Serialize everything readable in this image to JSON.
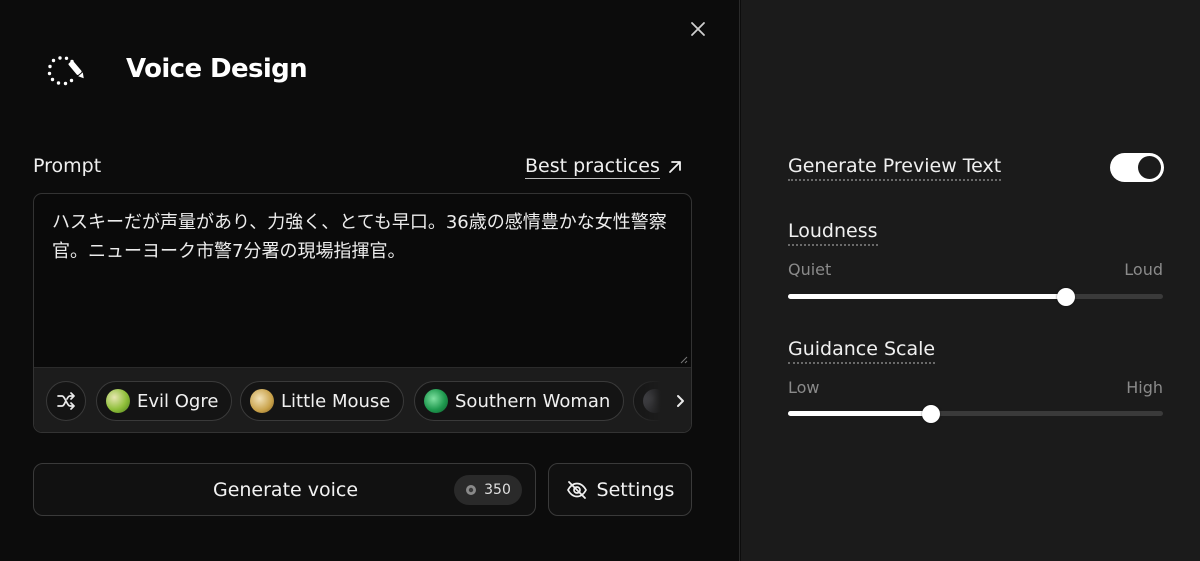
{
  "dialog": {
    "title": "Voice Design",
    "close_icon": "close-icon",
    "header_icon": "voice-design-icon"
  },
  "prompt": {
    "label": "Prompt",
    "best_practices_label": "Best practices",
    "text": "ハスキーだが声量があり、力強く、とても早口。36歳の感情豊かな女性警察官。ニューヨーク市警7分署の現場指揮官。"
  },
  "chips": [
    {
      "label": "Evil Ogre",
      "colors": [
        "#8fbf3a",
        "#e6e6b0"
      ]
    },
    {
      "label": "Little Mouse",
      "colors": [
        "#c9a24a",
        "#f2e2b8"
      ]
    },
    {
      "label": "Southern Woman",
      "colors": [
        "#1f9a4f",
        "#7fe0a0"
      ]
    },
    {
      "label": "",
      "colors": [
        "#505058",
        "#8a8a94"
      ]
    }
  ],
  "actions": {
    "generate_label": "Generate voice",
    "credits": "350",
    "settings_label": "Settings"
  },
  "settings": {
    "preview": {
      "label": "Generate Preview Text",
      "enabled": true
    },
    "loudness": {
      "label": "Loudness",
      "min_label": "Quiet",
      "max_label": "Loud",
      "value": 0.74
    },
    "guidance": {
      "label": "Guidance Scale",
      "min_label": "Low",
      "max_label": "High",
      "value": 0.38
    }
  },
  "colors": {
    "panel_left": "#0c0c0c",
    "panel_right": "#1b1b1b",
    "accent": "#ffffff"
  }
}
